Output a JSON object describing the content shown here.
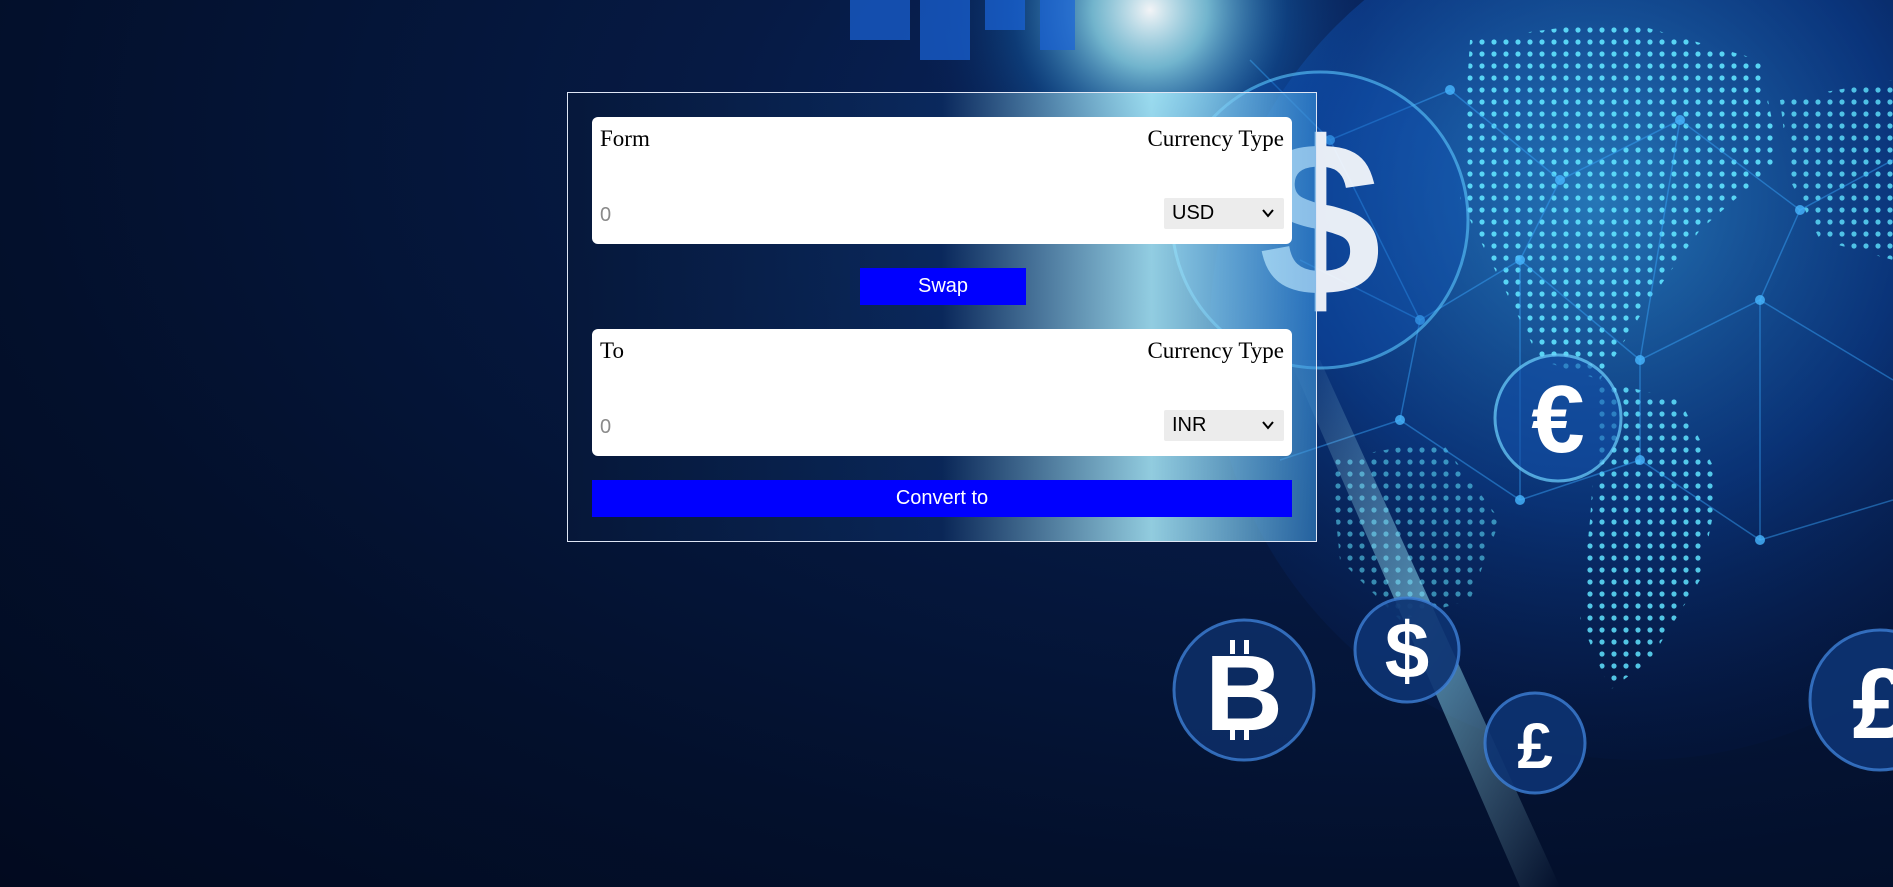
{
  "colors": {
    "button": "#0000ff",
    "button_text": "#ffffff",
    "panel": "#ffffff",
    "background": "#03102c"
  },
  "from": {
    "label": "Form",
    "currency_type_label": "Currency Type",
    "amount_placeholder": "0",
    "selected_currency": "USD"
  },
  "swap_label": "Swap",
  "to": {
    "label": "To",
    "currency_type_label": "Currency Type",
    "amount_placeholder": "0",
    "selected_currency": "INR"
  },
  "convert_label": "Convert to",
  "background_icons": [
    "globe-icon",
    "dollar-icon",
    "euro-icon",
    "bitcoin-icon",
    "dollar-icon",
    "pound-icon",
    "pound-icon"
  ]
}
